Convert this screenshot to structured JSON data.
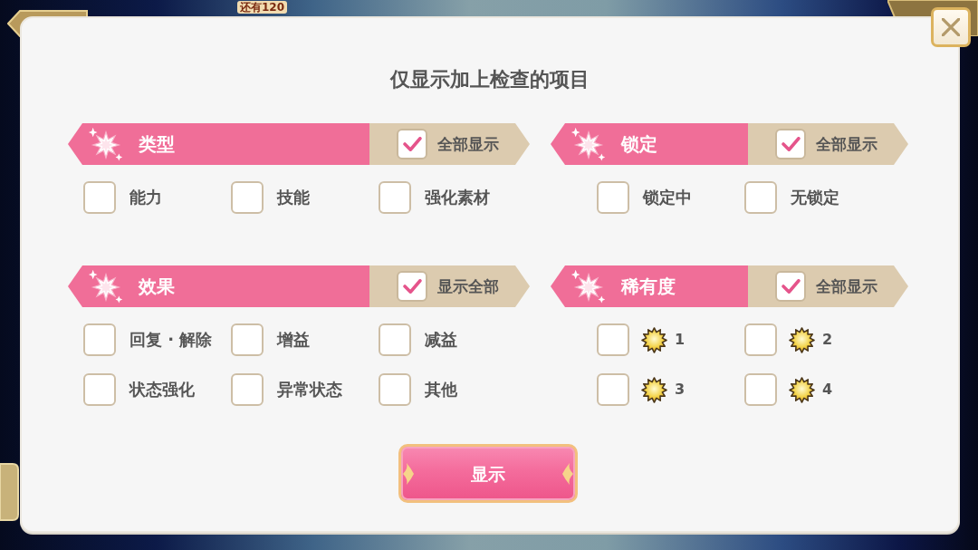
{
  "background": {
    "banner_text": "还有120"
  },
  "dialog": {
    "title": "仅显示加上检查的项目"
  },
  "sections": [
    {
      "title": "类型",
      "show_all": {
        "label": "全部显示",
        "checked": true
      },
      "options": [
        {
          "kind": "text",
          "label": "能力",
          "checked": false
        },
        {
          "kind": "text",
          "label": "技能",
          "checked": false
        },
        {
          "kind": "text",
          "label": "强化素材",
          "checked": false
        }
      ]
    },
    {
      "title": "锁定",
      "show_all": {
        "label": "全部显示",
        "checked": true
      },
      "options": [
        {
          "kind": "text",
          "label": "锁定中",
          "checked": false
        },
        {
          "kind": "text",
          "label": "无锁定",
          "checked": false
        }
      ]
    },
    {
      "title": "效果",
      "show_all": {
        "label": "显示全部",
        "checked": true
      },
      "options": [
        {
          "kind": "text",
          "label": "回复 · 解除",
          "checked": false
        },
        {
          "kind": "text",
          "label": "增益",
          "checked": false
        },
        {
          "kind": "text",
          "label": "减益",
          "checked": false
        },
        {
          "kind": "text",
          "label": "状态强化",
          "checked": false
        },
        {
          "kind": "text",
          "label": "异常状态",
          "checked": false
        },
        {
          "kind": "text",
          "label": "其他",
          "checked": false
        }
      ]
    },
    {
      "title": "稀有度",
      "show_all": {
        "label": "全部显示",
        "checked": true
      },
      "options": [
        {
          "kind": "rarity",
          "label": "1",
          "checked": false
        },
        {
          "kind": "rarity",
          "label": "2",
          "checked": false
        },
        {
          "kind": "rarity",
          "label": "3",
          "checked": false
        },
        {
          "kind": "rarity",
          "label": "4",
          "checked": false
        }
      ]
    }
  ],
  "confirm_button": "显示"
}
